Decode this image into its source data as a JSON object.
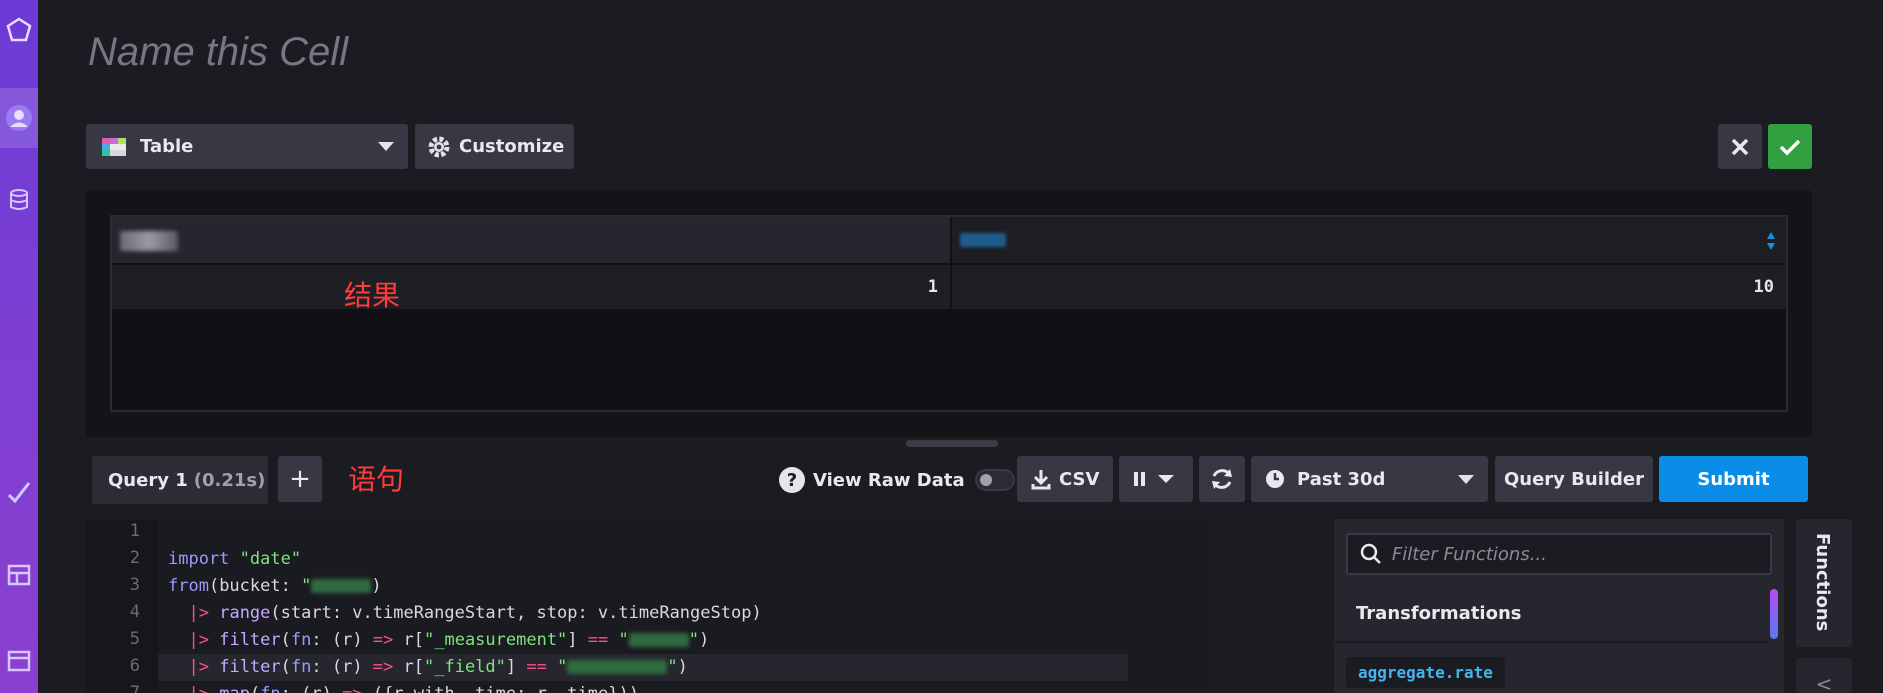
{
  "cell": {
    "title_placeholder": "Name this Cell"
  },
  "visualization": {
    "selected": "Table",
    "customize_label": "Customize"
  },
  "results": {
    "rows": [
      {
        "col1": "1",
        "col2": "10"
      }
    ],
    "annotation": "结果"
  },
  "query": {
    "tab_label": "Query 1",
    "tab_time": "(0.21s)",
    "add_label": "+",
    "annotation": "语句",
    "view_raw_label": "View Raw Data",
    "csv_label": "CSV",
    "time_range": "Past 30d",
    "query_builder_label": "Query Builder",
    "submit_label": "Submit"
  },
  "editor": {
    "line_numbers": [
      "1",
      "2",
      "3",
      "4",
      "5",
      "6",
      "7"
    ]
  },
  "functions": {
    "search_placeholder": "Filter Functions...",
    "category": "Transformations",
    "first_item": "aggregate.rate",
    "tab_label": "Functions",
    "collapse_label": "<"
  },
  "colors": {
    "accent": "#0a8de8",
    "confirm": "#32a041",
    "annotation": "#ff3b3b"
  }
}
